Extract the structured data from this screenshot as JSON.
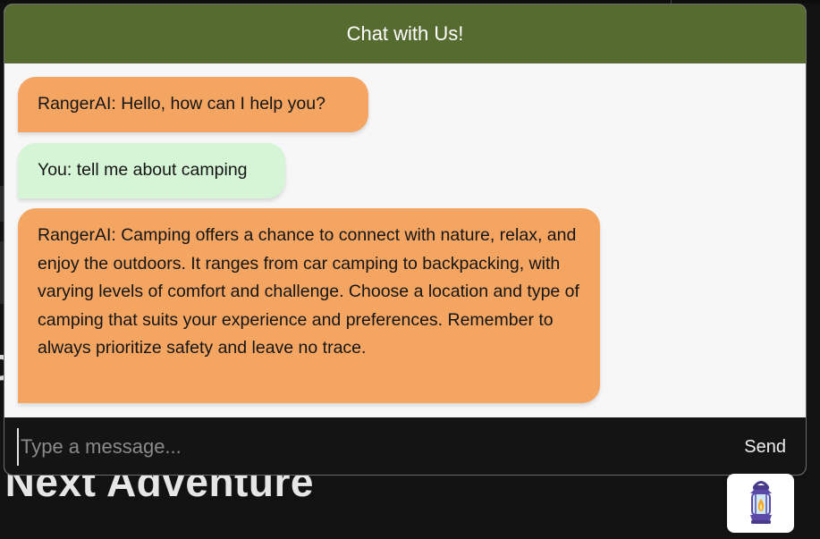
{
  "background": {
    "heading": "r Next Adventure",
    "left_fragment": "c"
  },
  "chat": {
    "title": "Chat with Us!",
    "messages": [
      {
        "sender": "bot",
        "text": "RangerAI: Hello, how can I help you?"
      },
      {
        "sender": "user",
        "text": "You: tell me about camping"
      },
      {
        "sender": "bot",
        "text": "RangerAI: Camping offers a chance to connect with nature, relax, and enjoy the outdoors. It ranges from car camping to backpacking, with varying levels of comfort and challenge. Choose a location and type of camping that suits your experience and preferences. Remember to always prioritize safety and leave no trace."
      }
    ],
    "input": {
      "placeholder": "Type a message...",
      "value": ""
    },
    "send_label": "Send"
  },
  "launcher": {
    "icon": "lantern-icon"
  },
  "colors": {
    "header": "#566b30",
    "bot_bubble": "#f4a562",
    "user_bubble": "#d6f5d6",
    "input_bar": "#141414",
    "page_bg": "#121212"
  }
}
